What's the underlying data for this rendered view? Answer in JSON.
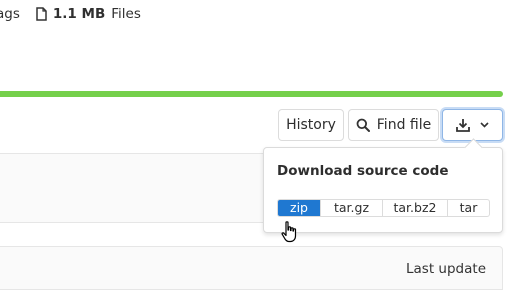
{
  "colors": {
    "accent": "#75d04b",
    "primary": "#1f78d1"
  },
  "stats": {
    "tags_label": "Tags",
    "files_size": "1.1 MB",
    "files_label": "Files",
    "files_icon": "file-icon"
  },
  "toolbar": {
    "history_label": "History",
    "find_file_label": "Find file",
    "find_icon": "search-icon",
    "download_icon": "download-icon",
    "dropdown_icon": "chevron-down-icon"
  },
  "download_dropdown": {
    "title": "Download source code",
    "formats": [
      "zip",
      "tar.gz",
      "tar.bz2",
      "tar"
    ],
    "selected": "zip"
  },
  "table": {
    "last_update_header": "Last update"
  }
}
